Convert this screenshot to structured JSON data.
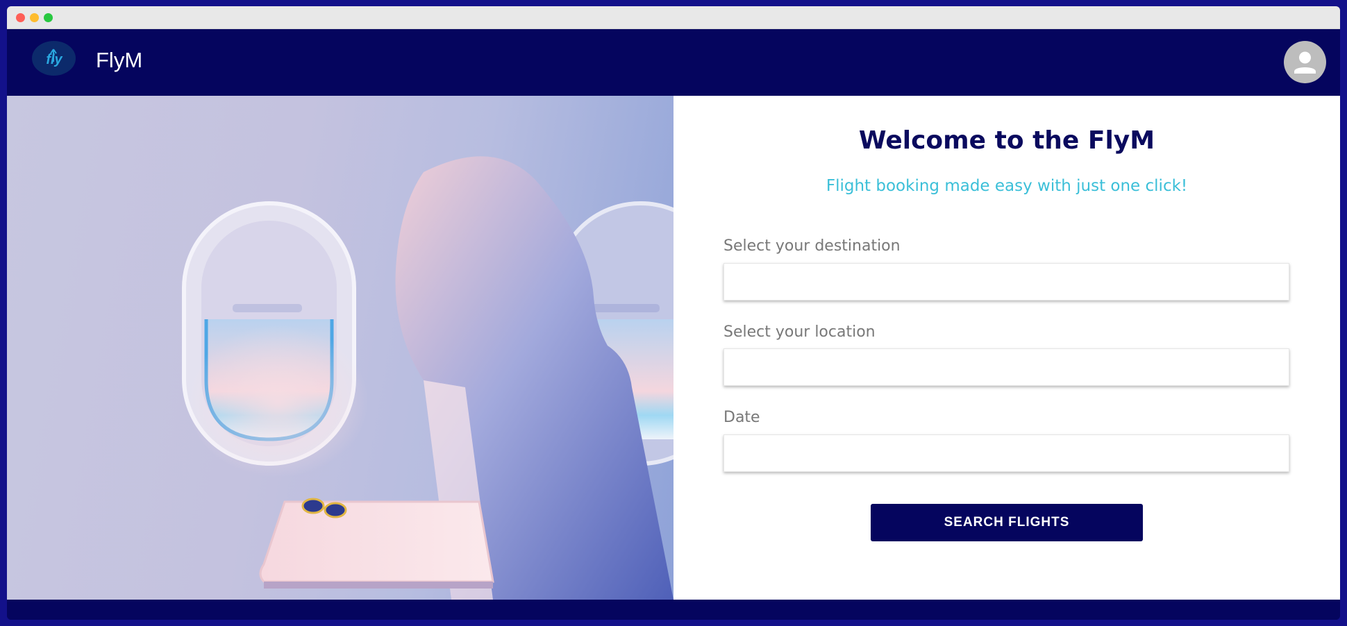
{
  "app": {
    "brand_name": "FlyM",
    "logo_text": "fly",
    "colors": {
      "primary": "#05055e",
      "accent": "#3bbfd8",
      "frame": "#13118a"
    }
  },
  "header": {
    "logo_icon": "fly-logo-icon",
    "avatar_icon": "user-avatar-icon"
  },
  "hero": {
    "image": "airplane-interior-seat-window-illustration"
  },
  "form": {
    "title": "Welcome to the FlyM",
    "subtitle": "Flight booking made easy with just one click!",
    "destination_label": "Select your destination",
    "destination_value": "",
    "location_label": "Select your location",
    "location_value": "",
    "date_label": "Date",
    "date_value": "",
    "search_button": "SEARCH FLIGHTS"
  }
}
